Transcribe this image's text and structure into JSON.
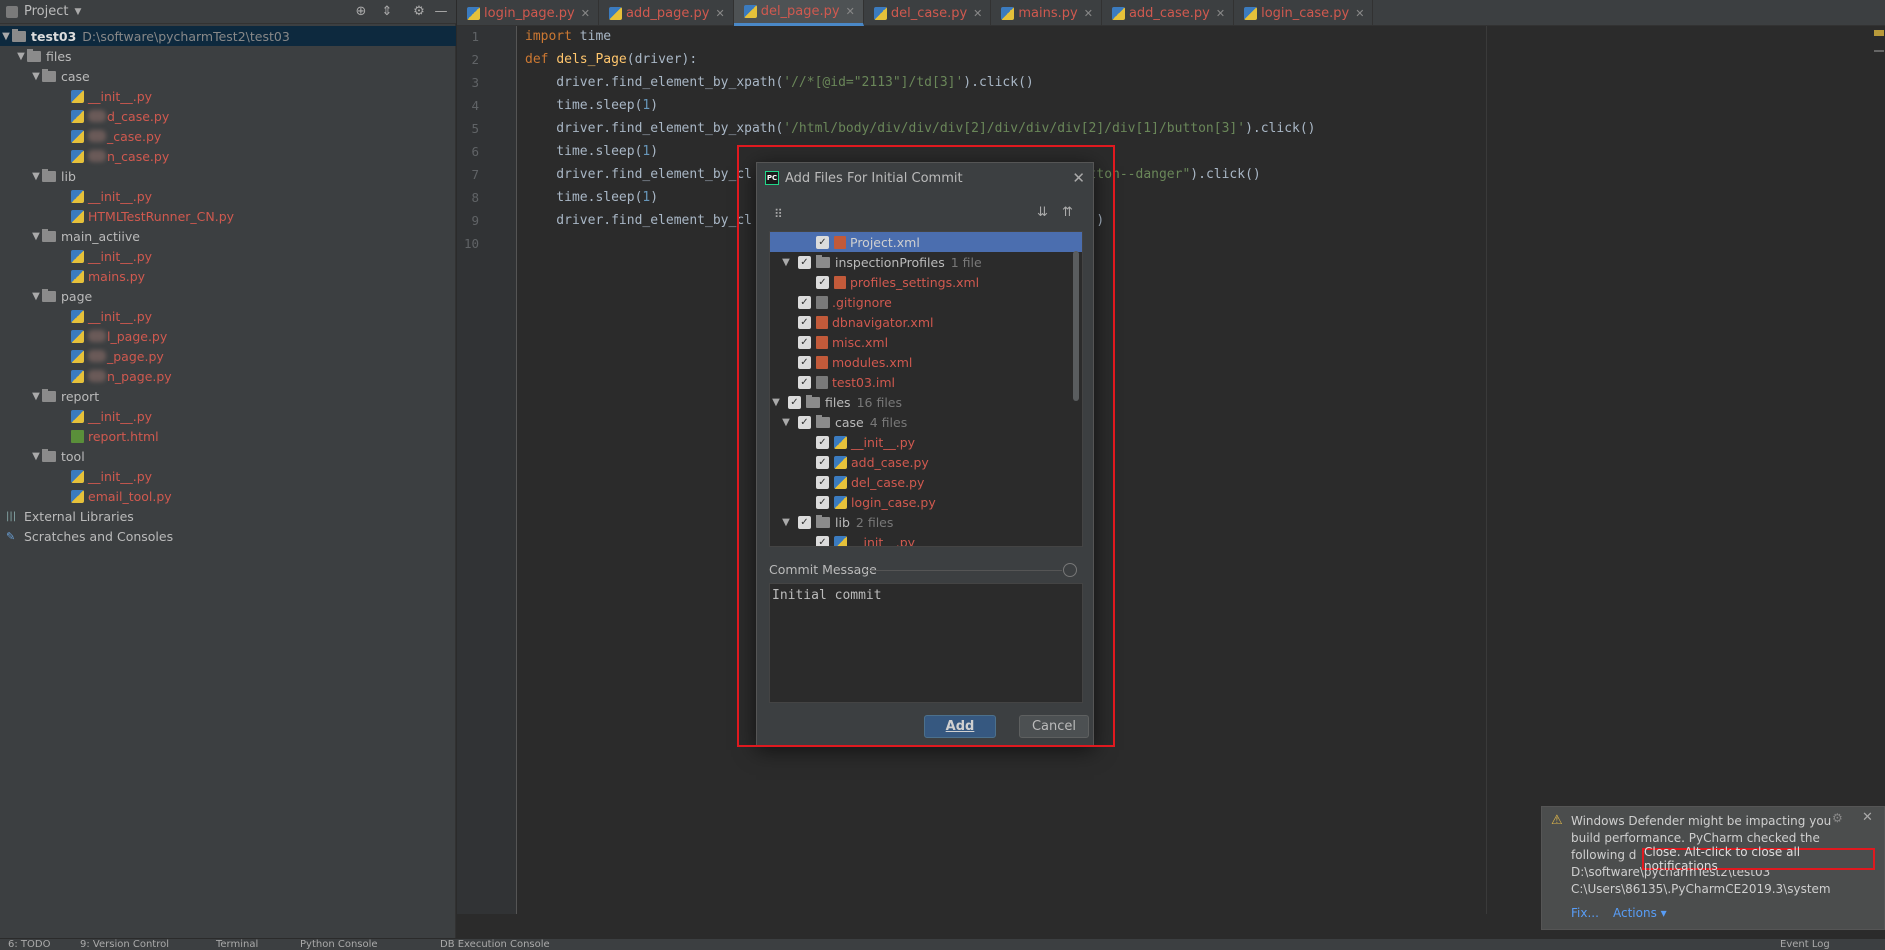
{
  "sidebar": {
    "title": "Project",
    "root_name": "test03",
    "root_path": "D:\\software\\pycharmTest2\\test03",
    "items": [
      {
        "label": "files",
        "type": "folder",
        "depth": 1,
        "expanded": true
      },
      {
        "label": "case",
        "type": "folder",
        "depth": 2,
        "expanded": true
      },
      {
        "label": "__init__.py",
        "type": "py",
        "depth": 3
      },
      {
        "label": "d_case.py",
        "type": "py",
        "depth": 3,
        "blurred": true
      },
      {
        "label": "_case.py",
        "type": "py",
        "depth": 3,
        "blurred": true
      },
      {
        "label": "n_case.py",
        "type": "py",
        "depth": 3,
        "blurred": true
      },
      {
        "label": "lib",
        "type": "folder",
        "depth": 2,
        "expanded": true
      },
      {
        "label": "__init__.py",
        "type": "py",
        "depth": 3
      },
      {
        "label": "HTMLTestRunner_CN.py",
        "type": "py",
        "depth": 3
      },
      {
        "label": "main_actiive",
        "type": "folder",
        "depth": 2,
        "expanded": true
      },
      {
        "label": "__init__.py",
        "type": "py",
        "depth": 3
      },
      {
        "label": "mains.py",
        "type": "py",
        "depth": 3
      },
      {
        "label": "page",
        "type": "folder",
        "depth": 2,
        "expanded": true
      },
      {
        "label": "__init__.py",
        "type": "py",
        "depth": 3
      },
      {
        "label": "l_page.py",
        "type": "py",
        "depth": 3,
        "blurred": true
      },
      {
        "label": "_page.py",
        "type": "py",
        "depth": 3,
        "blurred": true
      },
      {
        "label": "n_page.py",
        "type": "py",
        "depth": 3,
        "blurred": true
      },
      {
        "label": "report",
        "type": "folder",
        "depth": 2,
        "expanded": true
      },
      {
        "label": "__init__.py",
        "type": "py",
        "depth": 3
      },
      {
        "label": "report.html",
        "type": "html",
        "depth": 3
      },
      {
        "label": "tool",
        "type": "folder",
        "depth": 2,
        "expanded": true
      },
      {
        "label": "__init__.py",
        "type": "py",
        "depth": 3
      },
      {
        "label": "email_tool.py",
        "type": "py",
        "depth": 3
      },
      {
        "label": "External Libraries",
        "type": "lib",
        "depth": 0
      },
      {
        "label": "Scratches and Consoles",
        "type": "scratch",
        "depth": 0
      }
    ]
  },
  "tabs": [
    {
      "label": "login_page.py",
      "active": false
    },
    {
      "label": "add_page.py",
      "active": false
    },
    {
      "label": "del_page.py",
      "active": true
    },
    {
      "label": "del_case.py",
      "active": false
    },
    {
      "label": "mains.py",
      "active": false
    },
    {
      "label": "add_case.py",
      "active": false
    },
    {
      "label": "login_case.py",
      "active": false
    }
  ],
  "editor": {
    "line_numbers": [
      "1",
      "2",
      "3",
      "4",
      "5",
      "6",
      "7",
      "8",
      "9",
      "10"
    ],
    "lines": [
      [
        {
          "t": "import",
          "c": "kw"
        },
        {
          "t": " time",
          "c": ""
        }
      ],
      [
        {
          "t": "def",
          "c": "kw"
        },
        {
          "t": " ",
          "c": ""
        },
        {
          "t": "dels_Page",
          "c": "fn"
        },
        {
          "t": "(driver):",
          "c": ""
        }
      ],
      [
        {
          "t": "    driver.find_element_by_xpath(",
          "c": ""
        },
        {
          "t": "'//*[@id=\"2113\"]/td[3]'",
          "c": "str"
        },
        {
          "t": ").click()",
          "c": ""
        }
      ],
      [
        {
          "t": "    time.sleep(",
          "c": ""
        },
        {
          "t": "1",
          "c": "num"
        },
        {
          "t": ")",
          "c": ""
        }
      ],
      [
        {
          "t": "    driver.find_element_by_xpath(",
          "c": ""
        },
        {
          "t": "'/html/body/div/div/div[2]/div/div/div[2]/div[1]/button[3]'",
          "c": "str"
        },
        {
          "t": ").click()",
          "c": ""
        }
      ],
      [
        {
          "t": "    time.sleep(",
          "c": ""
        },
        {
          "t": "1",
          "c": "num"
        },
        {
          "t": ")",
          "c": ""
        }
      ],
      [
        {
          "t": "    driver.find_element_by_cl",
          "c": ""
        },
        {
          "t": "                                   ",
          "c": ""
        },
        {
          "t": ".swal-button--danger\"",
          "c": "str"
        },
        {
          "t": ").click()",
          "c": ""
        }
      ],
      [
        {
          "t": "    time.sleep(",
          "c": ""
        },
        {
          "t": "1",
          "c": "num"
        },
        {
          "t": ")",
          "c": ""
        }
      ],
      [
        {
          "t": "    driver.find_element_by_cl",
          "c": ""
        },
        {
          "t": "                                   ",
          "c": ""
        },
        {
          "t": "'",
          "c": "str"
        },
        {
          "t": ").click()",
          "c": ""
        }
      ],
      [
        {
          "t": "",
          "c": ""
        }
      ]
    ]
  },
  "dialog": {
    "title": "Add Files For Initial Commit",
    "tree": [
      {
        "label": "Project.xml",
        "depth": 4,
        "type": "xml",
        "checked": true,
        "selected": true
      },
      {
        "label": "inspectionProfiles",
        "count": "1 file",
        "depth": 3,
        "type": "folder",
        "checked": true,
        "expanded": true
      },
      {
        "label": "profiles_settings.xml",
        "depth": 4,
        "type": "xml",
        "checked": true
      },
      {
        "label": ".gitignore",
        "depth": 3,
        "type": "file",
        "checked": true
      },
      {
        "label": "dbnavigator.xml",
        "depth": 3,
        "type": "xml",
        "checked": true
      },
      {
        "label": "misc.xml",
        "depth": 3,
        "type": "xml",
        "checked": true
      },
      {
        "label": "modules.xml",
        "depth": 3,
        "type": "xml",
        "checked": true
      },
      {
        "label": "test03.iml",
        "depth": 3,
        "type": "file",
        "checked": true
      },
      {
        "label": "files",
        "count": "16 files",
        "depth": 2,
        "type": "folder",
        "checked": true,
        "expanded": true
      },
      {
        "label": "case",
        "count": "4 files",
        "depth": 3,
        "type": "folder",
        "checked": true,
        "expanded": true
      },
      {
        "label": "__init__.py",
        "depth": 4,
        "type": "py",
        "checked": true
      },
      {
        "label": "add_case.py",
        "depth": 4,
        "type": "py",
        "checked": true
      },
      {
        "label": "del_case.py",
        "depth": 4,
        "type": "py",
        "checked": true
      },
      {
        "label": "login_case.py",
        "depth": 4,
        "type": "py",
        "checked": true
      },
      {
        "label": "lib",
        "count": "2 files",
        "depth": 3,
        "type": "folder",
        "checked": true,
        "expanded": true
      },
      {
        "label": "__init__.py",
        "depth": 4,
        "type": "py",
        "checked": true
      }
    ],
    "commit_label": "Commit Message",
    "commit_value": "Initial commit",
    "add_label": "Add",
    "cancel_label": "Cancel"
  },
  "notification": {
    "line1": "Windows Defender might be impacting you",
    "line2": "build performance. PyCharm checked the",
    "line3": "following d",
    "line4": "D:\\software\\pycharmTest2\\test03",
    "line5": "C:\\Users\\86135\\.PyCharmCE2019.3\\system",
    "fix": "Fix...",
    "actions": "Actions ▾",
    "tooltip": "Close. Alt-click to close all notifications"
  },
  "bottom_bar": [
    "6: TODO",
    "9: Version Control",
    "Terminal",
    "Python Console",
    "DB Execution Console",
    "Event Log"
  ],
  "colors": {
    "accent": "#4a88c7",
    "highlight": "#e0191f",
    "file_modified": "#d0594f"
  }
}
